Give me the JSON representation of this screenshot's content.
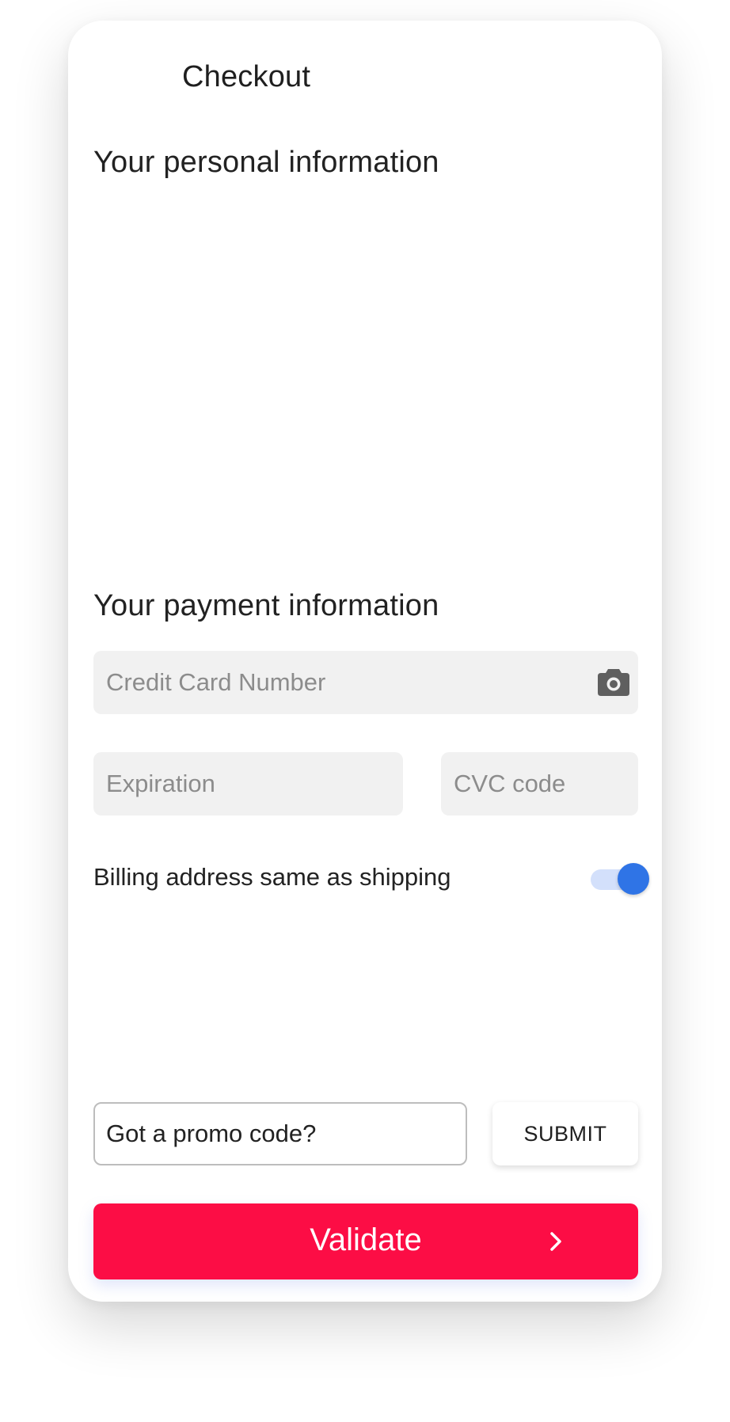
{
  "header": {
    "title": "Checkout"
  },
  "sections": {
    "personal_heading": "Your personal information",
    "payment_heading": "Your payment information"
  },
  "payment": {
    "card_number_placeholder": "Credit Card Number",
    "card_icon": "camera-icon",
    "expiration_placeholder": "Expiration",
    "cvc_placeholder": "CVC code"
  },
  "billing": {
    "label": "Billing address same as shipping",
    "toggle_on": true
  },
  "promo": {
    "placeholder": "Got a promo code?",
    "submit_label": "SUBMIT"
  },
  "actions": {
    "validate_label": "Validate",
    "validate_icon": "chevron-right-icon"
  },
  "colors": {
    "primary": "#fc0d45",
    "toggle_accent": "#2f74e6",
    "field_background": "#f1f1f1"
  }
}
